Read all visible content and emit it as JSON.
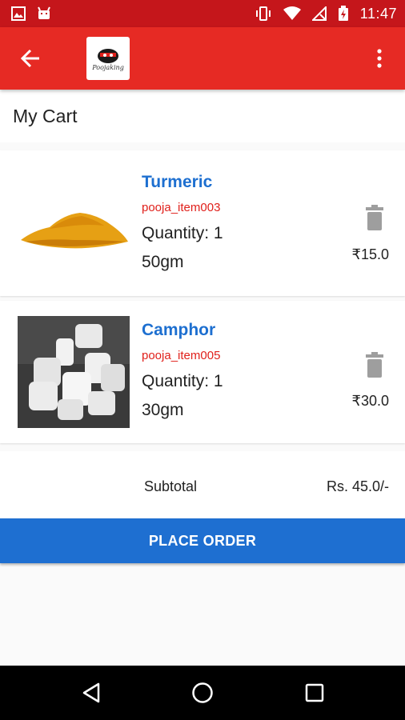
{
  "status_bar": {
    "time": "11:47",
    "left_icons": [
      "image-icon",
      "android-icon"
    ],
    "right_icons": [
      "vibrate-icon",
      "wifi-icon",
      "no-signal-icon",
      "battery-charging-icon"
    ]
  },
  "app_bar": {
    "back_icon": "arrow-back-icon",
    "logo_text": "Poojaking",
    "menu_icon": "more-vert-icon",
    "color": "#e62a24"
  },
  "page": {
    "title": "My Cart"
  },
  "cart": {
    "items": [
      {
        "name": "Turmeric",
        "code": "pooja_item003",
        "quantity": "Quantity: 1",
        "weight": "50gm",
        "price": "₹15.0",
        "image": "turmeric-powder-image"
      },
      {
        "name": "Camphor",
        "code": "pooja_item005",
        "quantity": "Quantity: 1",
        "weight": "30gm",
        "price": "₹30.0",
        "image": "camphor-tablets-image"
      }
    ],
    "subtotal_label": "Subtotal",
    "subtotal_value": "Rs. 45.0/-",
    "place_order_label": "PLACE ORDER"
  },
  "nav_bar": {
    "icons": [
      "back-triangle-icon",
      "home-circle-icon",
      "recents-square-icon"
    ]
  },
  "colors": {
    "accent_blue": "#1e6fd1",
    "code_red": "#e0201b",
    "status_red": "#c5161b"
  }
}
